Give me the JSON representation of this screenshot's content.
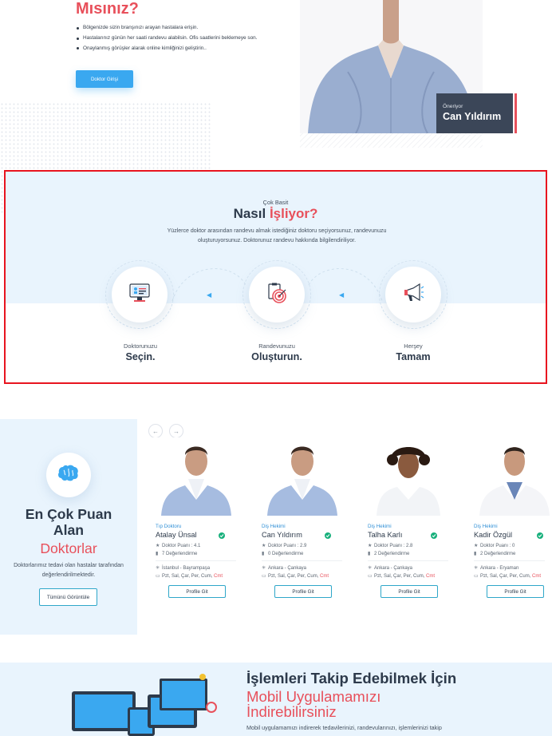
{
  "top": {
    "title": "Mısınız?",
    "bullets": [
      "Bölgenizde sizin branşınızı arayan hastalara erişin.",
      "Hastalarınız günün her saati randevu alabilsin. Ofis saatlerini beklemeye son.",
      "Onaylanmış görüşler alarak online kimliğinizi geliştirin.."
    ],
    "button_label": "Doktor Girişi",
    "recommend": {
      "small": "Öneriyor",
      "name": "Can Yıldırım"
    }
  },
  "how": {
    "eyebrow": "Çok Basit",
    "title_main": "Nasıl ",
    "title_accent": "İşliyor?",
    "description": "Yüzlerce doktor arasından randevu almak istediğiniz doktoru seçiyorsunuz, randevunuzu oluşturuyorsunuz. Doktorunuz randevu hakkında bilgilendiriliyor.",
    "steps": [
      {
        "label": "Doktorunuzu",
        "title": "Seçin.",
        "icon": "computer-profile-icon"
      },
      {
        "label": "Randevunuzu",
        "title": "Oluşturun.",
        "icon": "target-clipboard-icon"
      },
      {
        "label": "Herşey",
        "title": "Tamam",
        "icon": "megaphone-icon"
      }
    ]
  },
  "doctors": {
    "title_line1": "En Çok Puan",
    "title_line2": "Alan",
    "title_accent": "Doktorlar",
    "description": "Doktorlarımız tedavi olan hastalar tarafından değerlendirilmektedir.",
    "view_all_label": "Tümünü Görüntüle",
    "cards": [
      {
        "specialty": "Tıp Doktoru",
        "name": "Atalay Ünsal",
        "score": "Doktor Puanı : 4.1",
        "reviews": "7 Değerlendirme",
        "location": "İstanbul - Bayrampaşa",
        "days": "Pzt, Sal, Çar, Per, Cum, ",
        "days_accent": "Cmt",
        "button": "Profile Git"
      },
      {
        "specialty": "Diş Hekimi",
        "name": "Can Yıldırım",
        "score": "Doktor Puanı : 2.9",
        "reviews": "0 Değerlendirme",
        "location": "Ankara - Çankaya",
        "days": "Pzt, Sal, Çar, Per, Cum, ",
        "days_accent": "Cmt",
        "button": "Profile Git"
      },
      {
        "specialty": "Diş Hekimi",
        "name": "Talha Karlı",
        "score": "Doktor Puanı : 2.8",
        "reviews": "2 Değerlendirme",
        "location": "Ankara - Çankaya",
        "days": "Pzt, Sal, Çar, Per, Cum, ",
        "days_accent": "Cmt",
        "button": "Profile Git"
      },
      {
        "specialty": "Diş Hekimi",
        "name": "Kadir Özgül",
        "score": "Doktor Puanı : 0",
        "reviews": "2 Değerlendirme",
        "location": "Ankara - Eryaman",
        "days": "Pzt, Sal, Çar, Per, Cum, ",
        "days_accent": "Cmt",
        "button": "Profile Git"
      }
    ]
  },
  "app": {
    "title": "İşlemleri Takip Edebilmek İçin",
    "accent_line1": "Mobil Uygulamamızı",
    "accent_line2": "İndirebilirsiniz",
    "description": "Mobil uygulamamızı indirerek tedavilerinizi, randevularınızı, işlemlerinizi takip"
  },
  "colors": {
    "accent_red": "#e8505b",
    "primary_blue": "#3aa8f0",
    "light_bg": "#e9f4fd",
    "dark_text": "#2d3a4b",
    "verified_green": "#18b07c"
  }
}
